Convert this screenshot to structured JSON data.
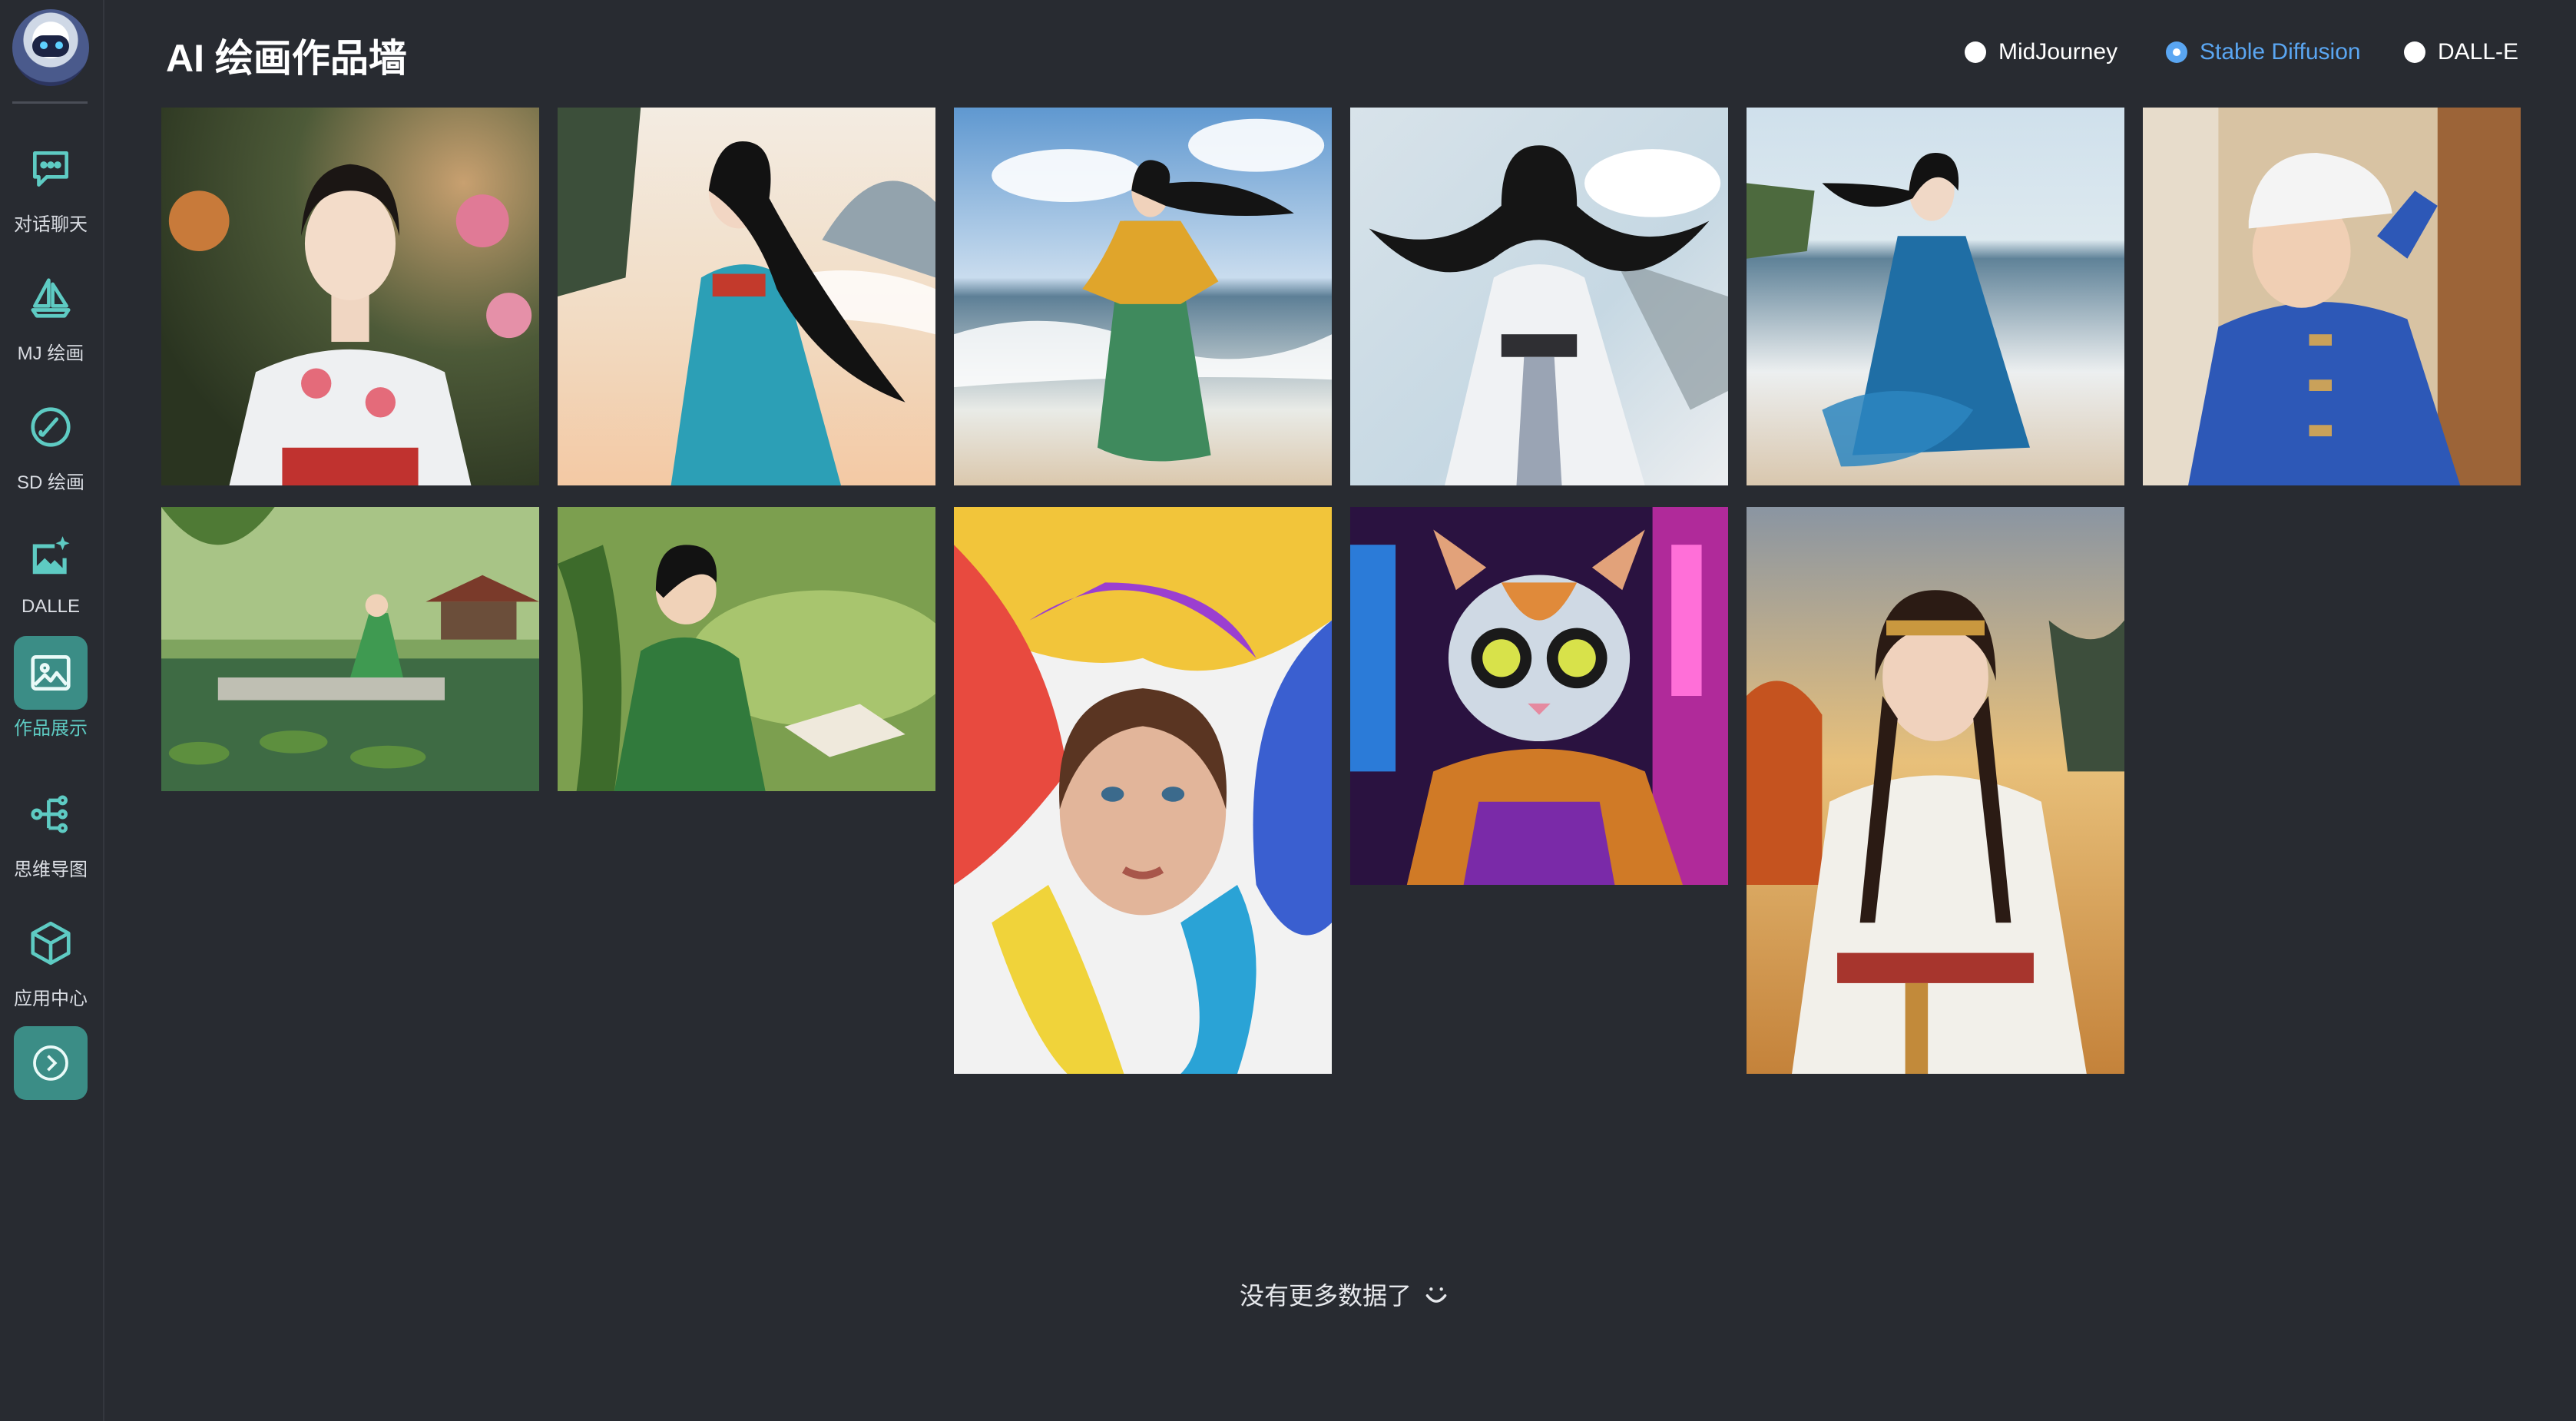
{
  "sidebar": {
    "items": [
      {
        "label": "对话聊天",
        "icon": "chat-bubble-icon",
        "active": false
      },
      {
        "label": "MJ 绘画",
        "icon": "sailboat-icon",
        "active": false
      },
      {
        "label": "SD 绘画",
        "icon": "brush-icon",
        "active": false
      },
      {
        "label": "DALLE",
        "icon": "image-sparkle-icon",
        "active": false
      },
      {
        "label": "作品展示",
        "icon": "picture-icon",
        "active": true
      },
      {
        "label": "思维导图",
        "icon": "mindmap-icon",
        "active": false
      },
      {
        "label": "应用中心",
        "icon": "cube-icon",
        "active": false
      }
    ],
    "expand_icon": "chevron-right-circle-icon"
  },
  "header": {
    "title": "AI 绘画作品墙"
  },
  "filters": {
    "options": [
      "MidJourney",
      "Stable Diffusion",
      "DALL-E"
    ],
    "selected": "Stable Diffusion"
  },
  "gallery": {
    "images": [
      {
        "subject": "woman-floral-qipao"
      },
      {
        "subject": "woman-blue-hanfu-beach"
      },
      {
        "subject": "woman-yellow-green-dress-beach"
      },
      {
        "subject": "woman-white-dress-beach"
      },
      {
        "subject": "woman-blue-dress-beach"
      },
      {
        "subject": "girl-white-cap-blue-jacket"
      },
      {
        "subject": "girl-reading-pond-pagoda"
      },
      {
        "subject": "girl-green-reading-pond"
      },
      {
        "subject": "woman-rainbow-paint-hair"
      },
      {
        "subject": "cyberpunk-cat-goggles"
      },
      {
        "subject": "woman-white-hanfu-autumn"
      }
    ]
  },
  "footer": {
    "end_text": "没有更多数据了",
    "icon": "smile-icon"
  },
  "colors": {
    "background": "#282b31",
    "accent": "#3b8d86",
    "accent_text": "#5ecbc3",
    "radio_selected": "#5aa6f2"
  }
}
